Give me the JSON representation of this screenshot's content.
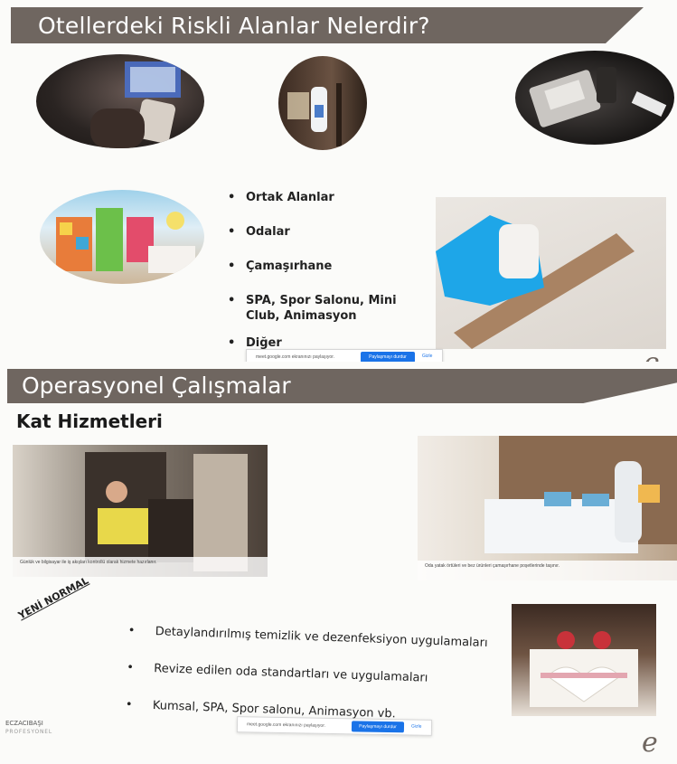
{
  "slide1": {
    "title": "Otellerdeki Riskli Alanlar Nelerdir?",
    "bullets": [
      "Ortak Alanlar",
      "Odalar",
      "Çamaşırhane",
      "SPA, Spor Salonu, Mini Club, Animasyon",
      "Diğer"
    ],
    "share_bar": {
      "text": "meet.google.com ekranınızı paylaşıyor.",
      "stop_label": "Paylaşmayı durdur",
      "hide_label": "Gizle"
    }
  },
  "slide2": {
    "title": "Operasyonel Çalışmalar",
    "section_title": "Kat Hizmetleri",
    "caption_left": "Günlük ve bilgisayar ile iş akışları kontrollü olarak hizmete hazırlanır.",
    "caption_right": "Oda yatak örtüleri ve bez ürünleri çamaşırhane poşetlerinde taşınır.",
    "new_normal": "YENİ NORMAL",
    "bullets": [
      "Detaylandırılmış temizlik ve dezenfeksiyon uygulamaları",
      "Revize edilen oda standartları ve uygulamaları",
      "Kumsal, SPA, Spor salonu, Animasyon vb."
    ],
    "brand": {
      "name": "ECZACIBAŞI",
      "sub": "PROFESYONEL"
    },
    "share_bar": {
      "text": "meet.google.com ekranınızı paylaşıyor.",
      "stop_label": "Paylaşmayı durdur",
      "hide_label": "Gizle"
    }
  },
  "colors": {
    "title_bar": "#6f6660",
    "page_bg": "#f3d888",
    "slide_bg": "#fbfbf9",
    "accent_blue": "#1a73e8"
  }
}
